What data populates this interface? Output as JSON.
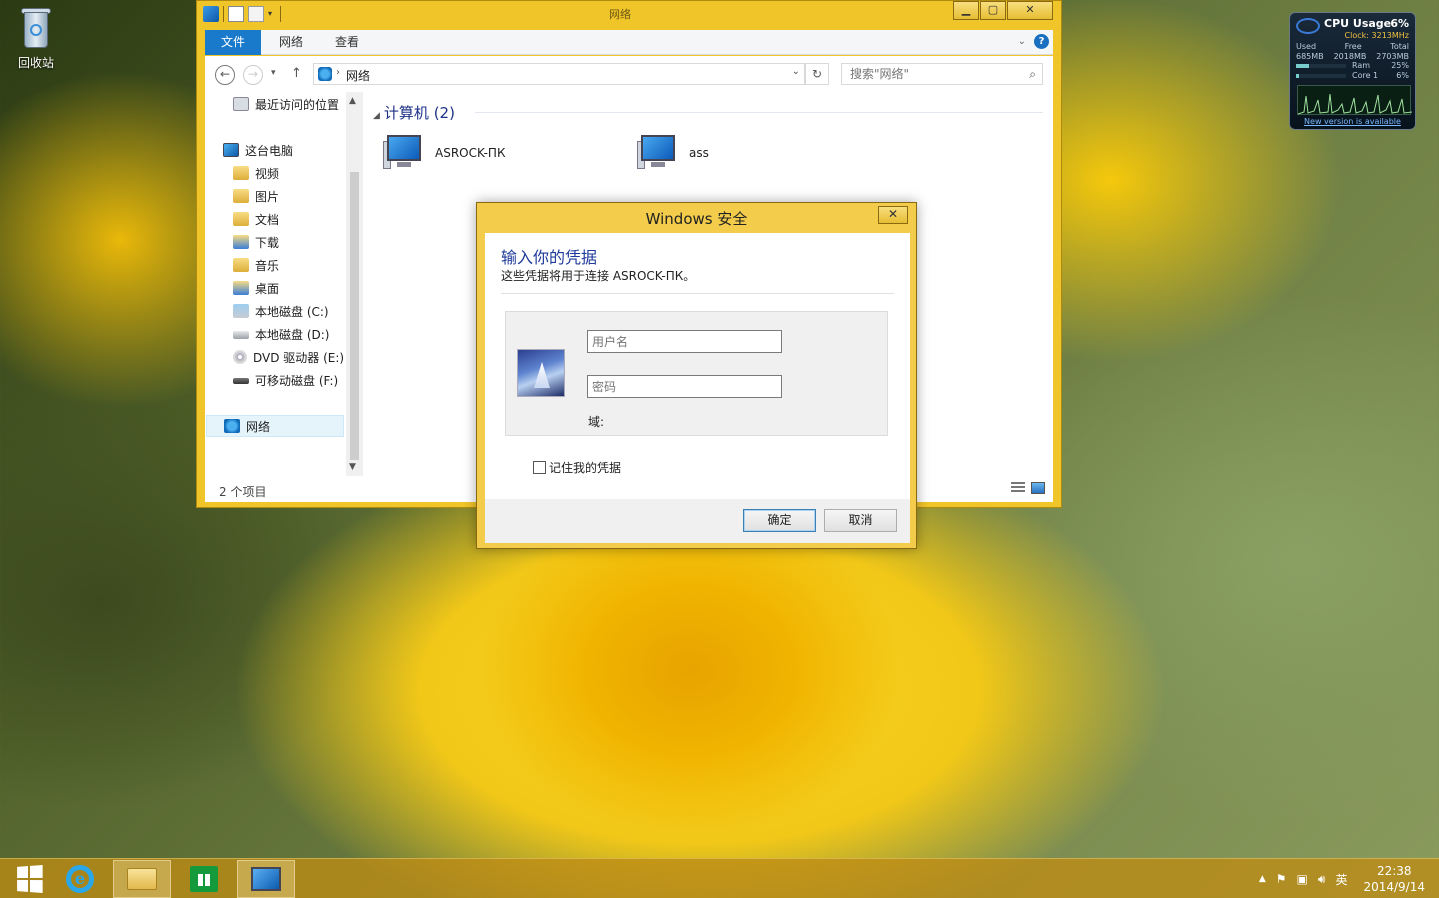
{
  "desktop": {
    "recycle_bin_label": "回收站"
  },
  "explorer": {
    "title": "网络",
    "ribbon_tabs": [
      "文件",
      "网络",
      "查看"
    ],
    "address_path": "网络",
    "search_placeholder": "搜索\"网络\"",
    "sidebar": [
      {
        "label": "最近访问的位置",
        "icon": "recent-places-icon"
      },
      {
        "label": "这台电脑",
        "icon": "this-pc-icon"
      },
      {
        "label": "视频",
        "icon": "folder-icon"
      },
      {
        "label": "图片",
        "icon": "folder-icon"
      },
      {
        "label": "文档",
        "icon": "folder-icon"
      },
      {
        "label": "下载",
        "icon": "folder-icon"
      },
      {
        "label": "音乐",
        "icon": "folder-icon"
      },
      {
        "label": "桌面",
        "icon": "folder-icon"
      },
      {
        "label": "本地磁盘 (C:)",
        "icon": "windows-drive-icon"
      },
      {
        "label": "本地磁盘 (D:)",
        "icon": "drive-icon"
      },
      {
        "label": "DVD 驱动器 (E:)",
        "icon": "dvd-icon"
      },
      {
        "label": "可移动磁盘 (F:)",
        "icon": "removable-drive-icon"
      },
      {
        "label": "网络",
        "icon": "network-icon"
      }
    ],
    "group_header": "计算机 (2)",
    "computers": [
      "ASROCK-ПК",
      "ass"
    ],
    "status": "2 个项目"
  },
  "dialog": {
    "title": "Windows 安全",
    "heading": "输入你的凭据",
    "subtitle": "这些凭据将用于连接 ASROCK-ПК。",
    "username_placeholder": "用户名",
    "password_placeholder": "密码",
    "domain_label": "域:",
    "remember_label": "记住我的凭据",
    "ok_label": "确定",
    "cancel_label": "取消"
  },
  "gadget": {
    "title": "CPU Usage",
    "cpu_pct": "6%",
    "clock": "Clock: 3213MHz",
    "headers": [
      "Used",
      "Free",
      "Total"
    ],
    "mem": [
      "685MB",
      "2018MB",
      "2703MB"
    ],
    "ram_label": "Ram",
    "ram_pct": "25%",
    "ram_fraction": 0.25,
    "core_label": "Core 1",
    "core_pct": "6%",
    "core_fraction": 0.06,
    "update_link": "New version is available"
  },
  "taskbar": {
    "ime": "英",
    "time": "22:38",
    "date": "2014/9/14"
  },
  "colors": {
    "ribbon_file_tab": "#1979ca",
    "dialog_heading": "#1e3a9a",
    "group_header": "#1e3287"
  }
}
